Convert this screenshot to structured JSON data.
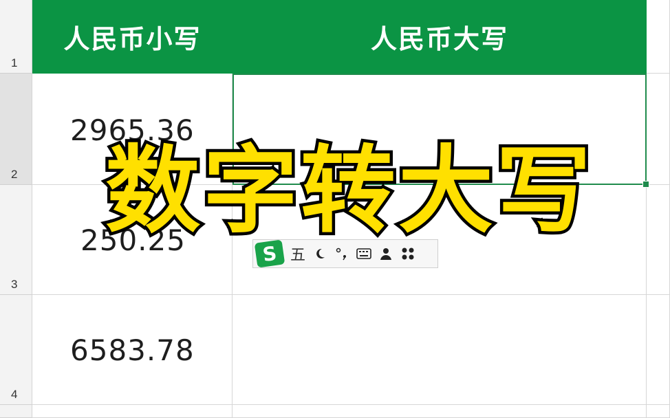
{
  "sheet": {
    "headers": [
      "人民币小写",
      "人民币大写"
    ],
    "rows": [
      {
        "row": "1"
      },
      {
        "row": "2",
        "amount": "2965.36"
      },
      {
        "row": "3",
        "amount": "250.25"
      },
      {
        "row": "4",
        "amount": "6583.78"
      }
    ]
  },
  "overlay": {
    "title": "数字转大写"
  },
  "ime": {
    "mode_label": "五"
  },
  "colors": {
    "header_bg": "#0b9444",
    "selection": "#1f8b4c",
    "overlay_fill": "#ffe000",
    "overlay_stroke": "#000000"
  }
}
